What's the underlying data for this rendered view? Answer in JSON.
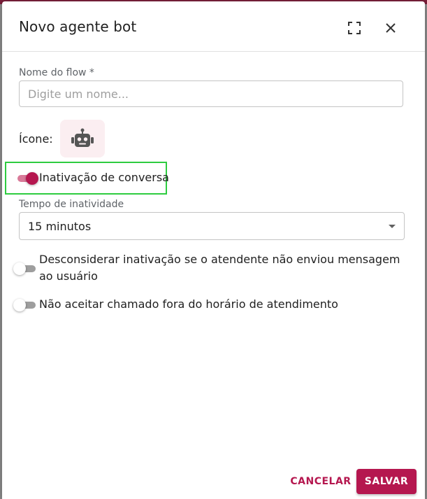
{
  "dialog": {
    "title": "Novo agente bot",
    "expand_icon": "fullscreen-icon",
    "close_icon": "close-icon"
  },
  "form": {
    "name_label": "Nome do flow *",
    "name_placeholder": "Digite um nome...",
    "name_value": "",
    "icon_label": "Ícone:",
    "icon_name": "robot-icon",
    "inactivation_toggle": {
      "label": "Inativação de conversa",
      "checked": true
    },
    "inactivity_time_label": "Tempo de inatividade",
    "inactivity_time_value": "15 minutos",
    "ignore_inactivation_toggle": {
      "label": "Desconsiderar inativação se o atendente não enviou mensagem ao usuário",
      "checked": false
    },
    "off_hours_toggle": {
      "label": "Não aceitar chamado fora do horário de atendimento",
      "checked": false
    }
  },
  "actions": {
    "cancel_label": "CANCELAR",
    "save_label": "SALVAR"
  },
  "colors": {
    "accent": "#b5174f",
    "highlight_border": "#2ecc40",
    "icon_bg": "#fbeef1"
  }
}
